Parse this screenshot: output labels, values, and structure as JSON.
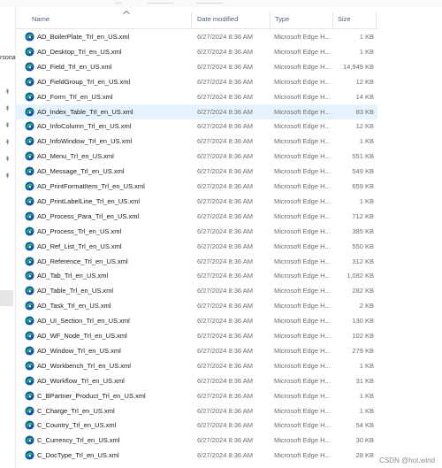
{
  "columns": {
    "name": "Name",
    "date_modified": "Date modified",
    "type": "Type",
    "size": "Size"
  },
  "nav": {
    "fragment": "rsona"
  },
  "selected_index": 5,
  "files": [
    {
      "name": "AD_BoilerPlate_Trl_en_US.xml",
      "date": "6/27/2024 8:36 AM",
      "type": "Microsoft Edge H...",
      "size": "1 KB"
    },
    {
      "name": "AD_Desktop_Trl_en_US.xml",
      "date": "6/27/2024 8:36 AM",
      "type": "Microsoft Edge H...",
      "size": "1 KB"
    },
    {
      "name": "AD_Field_Trl_en_US.xml",
      "date": "6/27/2024 8:36 AM",
      "type": "Microsoft Edge H...",
      "size": "14,949 KB"
    },
    {
      "name": "AD_FieldGroup_Trl_en_US.xml",
      "date": "6/27/2024 8:36 AM",
      "type": "Microsoft Edge H...",
      "size": "12 KB"
    },
    {
      "name": "AD_Form_Trl_en_US.xml",
      "date": "6/27/2024 8:36 AM",
      "type": "Microsoft Edge H...",
      "size": "14 KB"
    },
    {
      "name": "AD_Index_Table_Trl_en_US.xml",
      "date": "6/27/2024 8:36 AM",
      "type": "Microsoft Edge H...",
      "size": "83 KB"
    },
    {
      "name": "AD_InfoColumn_Trl_en_US.xml",
      "date": "6/27/2024 8:36 AM",
      "type": "Microsoft Edge H...",
      "size": "12 KB"
    },
    {
      "name": "AD_InfoWindow_Trl_en_US.xml",
      "date": "6/27/2024 8:36 AM",
      "type": "Microsoft Edge H...",
      "size": "1 KB"
    },
    {
      "name": "AD_Menu_Trl_en_US.xml",
      "date": "6/27/2024 8:36 AM",
      "type": "Microsoft Edge H...",
      "size": "551 KB"
    },
    {
      "name": "AD_Message_Trl_en_US.xml",
      "date": "6/27/2024 8:36 AM",
      "type": "Microsoft Edge H...",
      "size": "549 KB"
    },
    {
      "name": "AD_PrintFormatItem_Trl_en_US.xml",
      "date": "6/27/2024 8:36 AM",
      "type": "Microsoft Edge H...",
      "size": "659 KB"
    },
    {
      "name": "AD_PrintLabelLine_Trl_en_US.xml",
      "date": "6/27/2024 8:36 AM",
      "type": "Microsoft Edge H...",
      "size": "1 KB"
    },
    {
      "name": "AD_Process_Para_Trl_en_US.xml",
      "date": "6/27/2024 8:36 AM",
      "type": "Microsoft Edge H...",
      "size": "712 KB"
    },
    {
      "name": "AD_Process_Trl_en_US.xml",
      "date": "6/27/2024 8:36 AM",
      "type": "Microsoft Edge H...",
      "size": "385 KB"
    },
    {
      "name": "AD_Ref_List_Trl_en_US.xml",
      "date": "6/27/2024 8:36 AM",
      "type": "Microsoft Edge H...",
      "size": "550 KB"
    },
    {
      "name": "AD_Reference_Trl_en_US.xml",
      "date": "6/27/2024 8:36 AM",
      "type": "Microsoft Edge H...",
      "size": "312 KB"
    },
    {
      "name": "AD_Tab_Trl_en_US.xml",
      "date": "6/27/2024 8:36 AM",
      "type": "Microsoft Edge H...",
      "size": "1,082 KB"
    },
    {
      "name": "AD_Table_Trl_en_US.xml",
      "date": "6/27/2024 8:36 AM",
      "type": "Microsoft Edge H...",
      "size": "282 KB"
    },
    {
      "name": "AD_Task_Trl_en_US.xml",
      "date": "6/27/2024 8:36 AM",
      "type": "Microsoft Edge H...",
      "size": "2 KB"
    },
    {
      "name": "AD_UI_Section_Trl_en_US.xml",
      "date": "6/27/2024 8:36 AM",
      "type": "Microsoft Edge H...",
      "size": "130 KB"
    },
    {
      "name": "AD_WF_Node_Trl_en_US.xml",
      "date": "6/27/2024 8:36 AM",
      "type": "Microsoft Edge H...",
      "size": "102 KB"
    },
    {
      "name": "AD_Window_Trl_en_US.xml",
      "date": "6/27/2024 8:36 AM",
      "type": "Microsoft Edge H...",
      "size": "279 KB"
    },
    {
      "name": "AD_Workbench_Trl_en_US.xml",
      "date": "6/27/2024 8:36 AM",
      "type": "Microsoft Edge H...",
      "size": "1 KB"
    },
    {
      "name": "AD_Workflow_Trl_en_US.xml",
      "date": "6/27/2024 8:36 AM",
      "type": "Microsoft Edge H...",
      "size": "31 KB"
    },
    {
      "name": "C_BPartner_Product_Trl_en_US.xml",
      "date": "6/27/2024 8:36 AM",
      "type": "Microsoft Edge H...",
      "size": "1 KB"
    },
    {
      "name": "C_Charge_Trl_en_US.xml",
      "date": "6/27/2024 8:36 AM",
      "type": "Microsoft Edge H...",
      "size": "1 KB"
    },
    {
      "name": "C_Country_Trl_en_US.xml",
      "date": "6/27/2024 8:36 AM",
      "type": "Microsoft Edge H...",
      "size": "54 KB"
    },
    {
      "name": "C_Currency_Trl_en_US.xml",
      "date": "6/27/2024 8:36 AM",
      "type": "Microsoft Edge H...",
      "size": "30 KB"
    },
    {
      "name": "C_DocType_Trl_en_US.xml",
      "date": "6/27/2024 8:36 AM",
      "type": "Microsoft Edge H...",
      "size": "28 KB"
    }
  ],
  "watermark": "CSDN @hot.wind",
  "colors": {
    "selected_row": "#e5f3ff",
    "header_text": "#4c607a",
    "edge_blue": "#0c59a4",
    "edge_green": "#3dbd6a"
  }
}
